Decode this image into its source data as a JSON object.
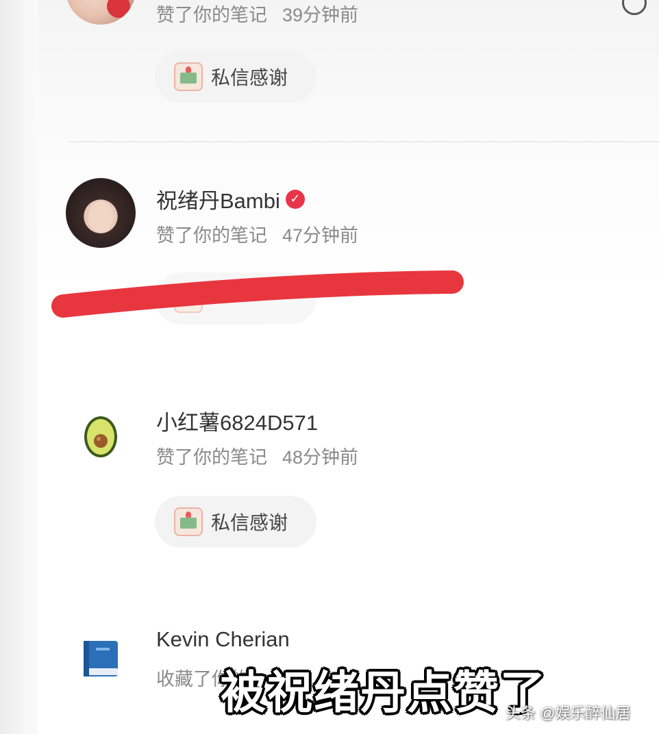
{
  "notifications": [
    {
      "subtitle": "赞了你的笔记",
      "time": "39分钟前",
      "thanks_label": "私信感谢"
    },
    {
      "name": "祝绪丹Bambi",
      "verified": true,
      "subtitle": "赞了你的笔记",
      "time": "47分钟前"
    },
    {
      "name": "小红薯6824D571",
      "subtitle": "赞了你的笔记",
      "time": "48分钟前",
      "thanks_label": "私信感谢"
    },
    {
      "name": "Kevin Cherian",
      "subtitle": "收藏了你的"
    }
  ],
  "overlay": {
    "caption": "被祝绪丹点赞了",
    "watermark": "头条 @娱乐醉仙居",
    "highlight_color": "#e8363f"
  }
}
